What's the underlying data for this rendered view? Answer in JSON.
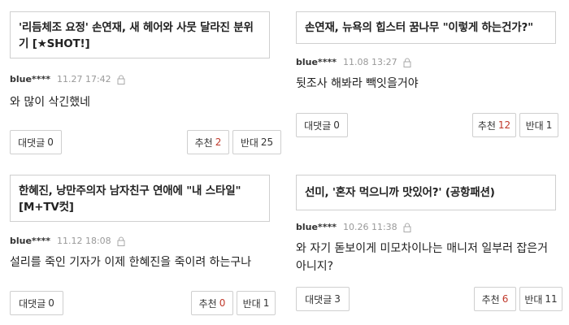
{
  "cards": [
    {
      "headline": "'리듬체조 요정' 손연재, 새 헤어와 사뭇 달라진 분위기 [★SHOT!]",
      "user": "blue****",
      "time": "11.27 17:42",
      "comment": "와 많이 삭긴했네",
      "reply_label": "대댓글",
      "reply_count": "0",
      "like_label": "추천",
      "like_count": "2",
      "dislike_label": "반대",
      "dislike_count": "25"
    },
    {
      "headline": "손연재, 뉴욕의 힙스터 꿈나무 \"이렇게 하는건가?\"",
      "user": "blue****",
      "time": "11.08 13:27",
      "comment": "뒷조사 해봐라 빽잇을거야",
      "reply_label": "대댓글",
      "reply_count": "0",
      "like_label": "추천",
      "like_count": "12",
      "dislike_label": "반대",
      "dislike_count": "1"
    },
    {
      "headline": "한혜진, 낭만주의자 남자친구 연애에 \"내 스타일\" [M+TV컷]",
      "user": "blue****",
      "time": "11.12 18:08",
      "comment": "설리를 죽인 기자가 이제 한혜진을 죽이려 하는구나",
      "reply_label": "대댓글",
      "reply_count": "0",
      "like_label": "추천",
      "like_count": "0",
      "dislike_label": "반대",
      "dislike_count": "1"
    },
    {
      "headline": "선미, '혼자 먹으니까 맛있어?' (공항패션)",
      "user": "blue****",
      "time": "10.26 11:38",
      "comment": "와 자기 돋보이게 미모차이나는 매니저 일부러 잡은거 아니지?",
      "reply_label": "대댓글",
      "reply_count": "3",
      "like_label": "추천",
      "like_count": "6",
      "dislike_label": "반대",
      "dislike_count": "11"
    }
  ],
  "icons": {
    "lock": "lock-icon"
  },
  "colors": {
    "like_count": "#c0392b",
    "time": "#999999",
    "border": "#cfcfcf"
  }
}
